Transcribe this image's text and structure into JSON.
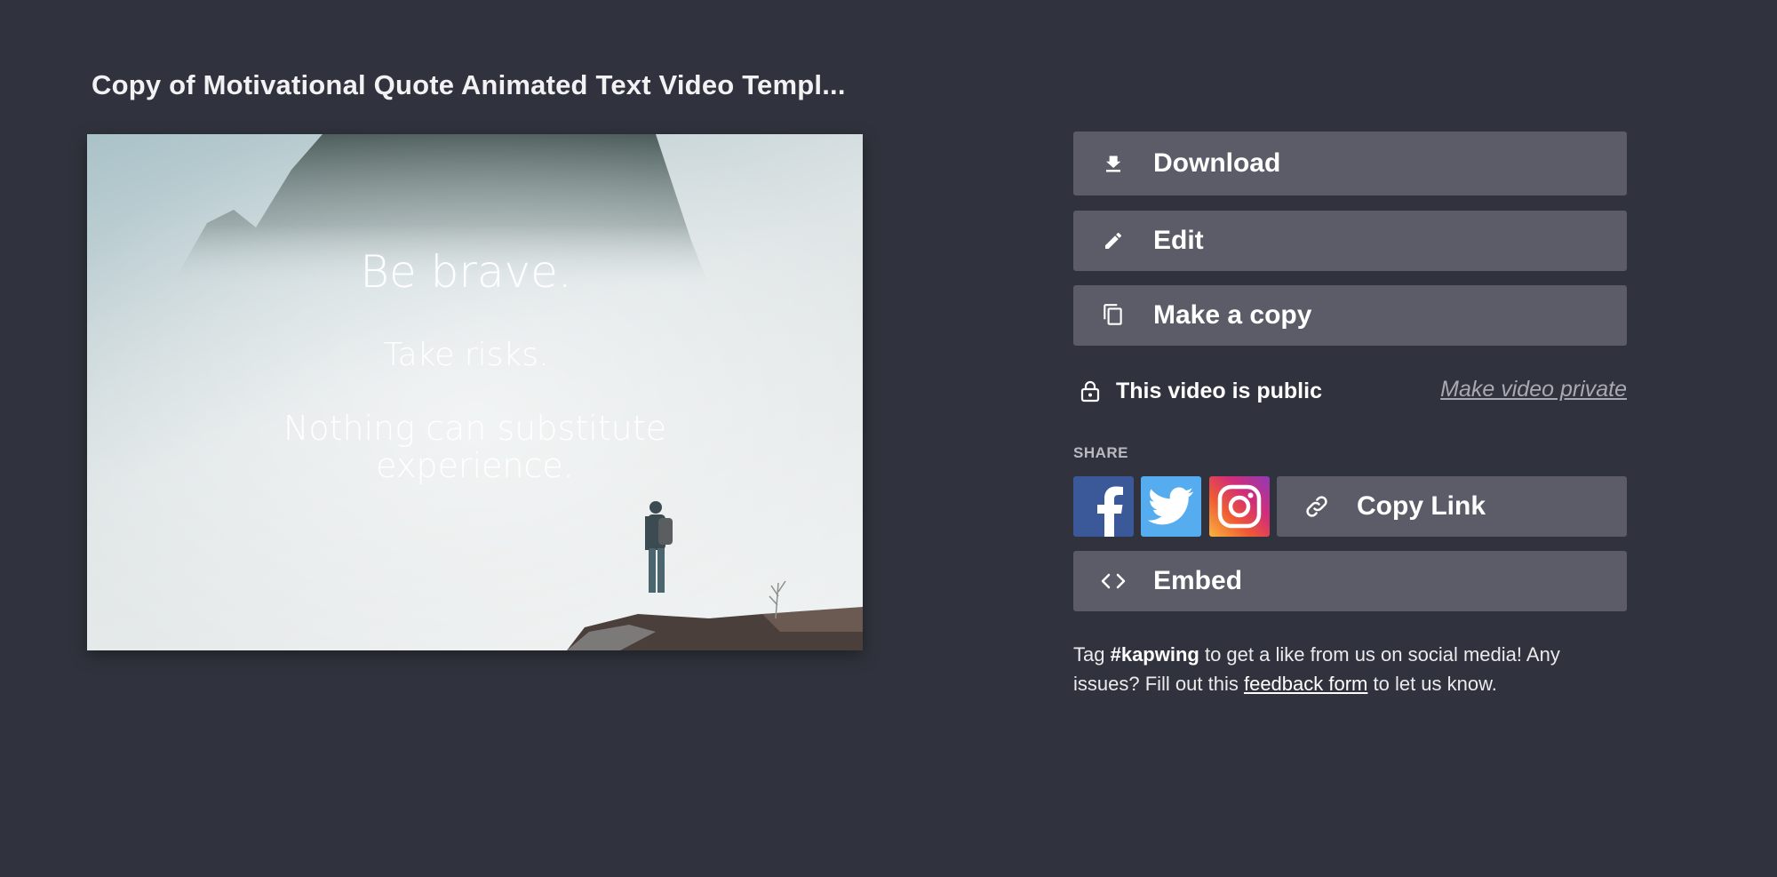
{
  "page": {
    "title": "Copy of Motivational Quote Animated Text Video Templ..."
  },
  "video": {
    "line1": "Be brave.",
    "line2": "Take risks.",
    "line3a": "Nothing can substitute",
    "line3b": "experience."
  },
  "actions": {
    "download": "Download",
    "edit": "Edit",
    "make_copy": "Make a copy",
    "embed": "Embed"
  },
  "privacy": {
    "status": "This video is public",
    "toggle": "Make video private"
  },
  "share": {
    "label": "SHARE",
    "copy_link": "Copy Link",
    "networks": [
      "facebook-icon",
      "twitter-icon",
      "instagram-icon"
    ]
  },
  "note": {
    "prefix": "Tag ",
    "hashtag": "#kapwing",
    "middle": " to get a like from us on social media! Any issues? Fill out this ",
    "link": "feedback form",
    "suffix": " to let us know."
  },
  "colors": {
    "background": "#30333d",
    "button": "#5b5c67",
    "facebook": "#3b5998",
    "twitter": "#55acee"
  }
}
